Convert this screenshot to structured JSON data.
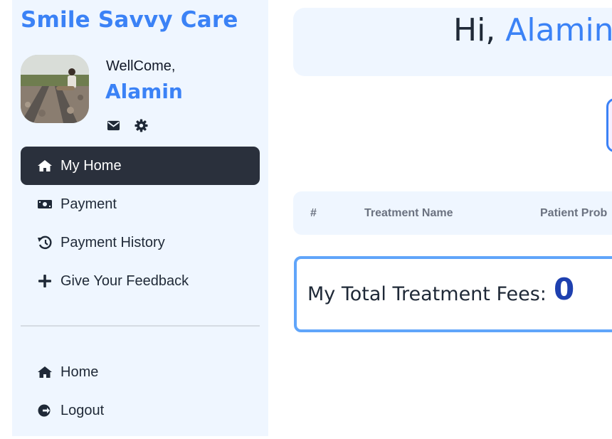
{
  "brand": {
    "title": "Smile Savvy Care",
    "color": "#3b82f6"
  },
  "profile": {
    "welcome": "WellCome,",
    "name": "Alamin",
    "icons": [
      "mail-icon",
      "gear-icon"
    ]
  },
  "sidebar": {
    "items": [
      {
        "label": "My Home",
        "icon": "home-icon",
        "active": true
      },
      {
        "label": "Payment",
        "icon": "money-icon"
      },
      {
        "label": "Payment History",
        "icon": "history-icon"
      },
      {
        "label": "Give Your Feedback",
        "icon": "plus-icon"
      }
    ],
    "footer_items": [
      {
        "label": "Home",
        "icon": "home-icon"
      },
      {
        "label": "Logout",
        "icon": "logout-icon"
      }
    ]
  },
  "header": {
    "greeting": "Hi,",
    "name": "Alamin"
  },
  "table": {
    "headers": [
      "#",
      "Treatment Name",
      "Patient Prob"
    ]
  },
  "fees": {
    "label": "My Total Treatment Fees:",
    "value": "0"
  },
  "colors": {
    "accent": "#3b82f6",
    "active_nav": "#2a303c",
    "panel_bg": "#eff6ff",
    "fees_value": "#1e40af"
  }
}
